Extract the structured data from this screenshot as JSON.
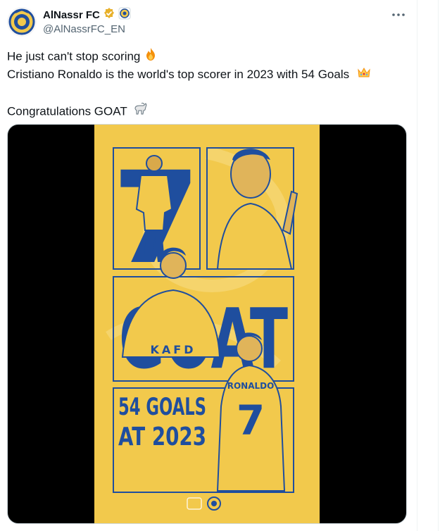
{
  "account": {
    "name": "AlNassr FC",
    "handle": "@AlNassrFC_EN",
    "verified_icon": "verified-badge-icon",
    "affiliate_icon": "club-crest-badge-icon"
  },
  "tweet": {
    "lines": [
      "He just can't stop scoring",
      "Cristiano Ronaldo is the world's top scorer in 2023 with 54 Goals",
      "",
      "Congratulations GOAT"
    ],
    "emojis": [
      "fire-emoji",
      "crown-emoji",
      "goat-emoji"
    ]
  },
  "media": {
    "poster": {
      "big_number": "7",
      "big_word": "GOAT",
      "stat_line1": "54 GOALS",
      "stat_line2": "AT 2023",
      "jersey_sponsor": "KAFD",
      "jersey_name": "RONALDO",
      "jersey_number": "7"
    }
  },
  "colors": {
    "poster_yellow": "#f2c94c",
    "poster_blue": "#1f4e9e",
    "handle_gray": "#536471",
    "verified_gold": "#e8b12c"
  }
}
